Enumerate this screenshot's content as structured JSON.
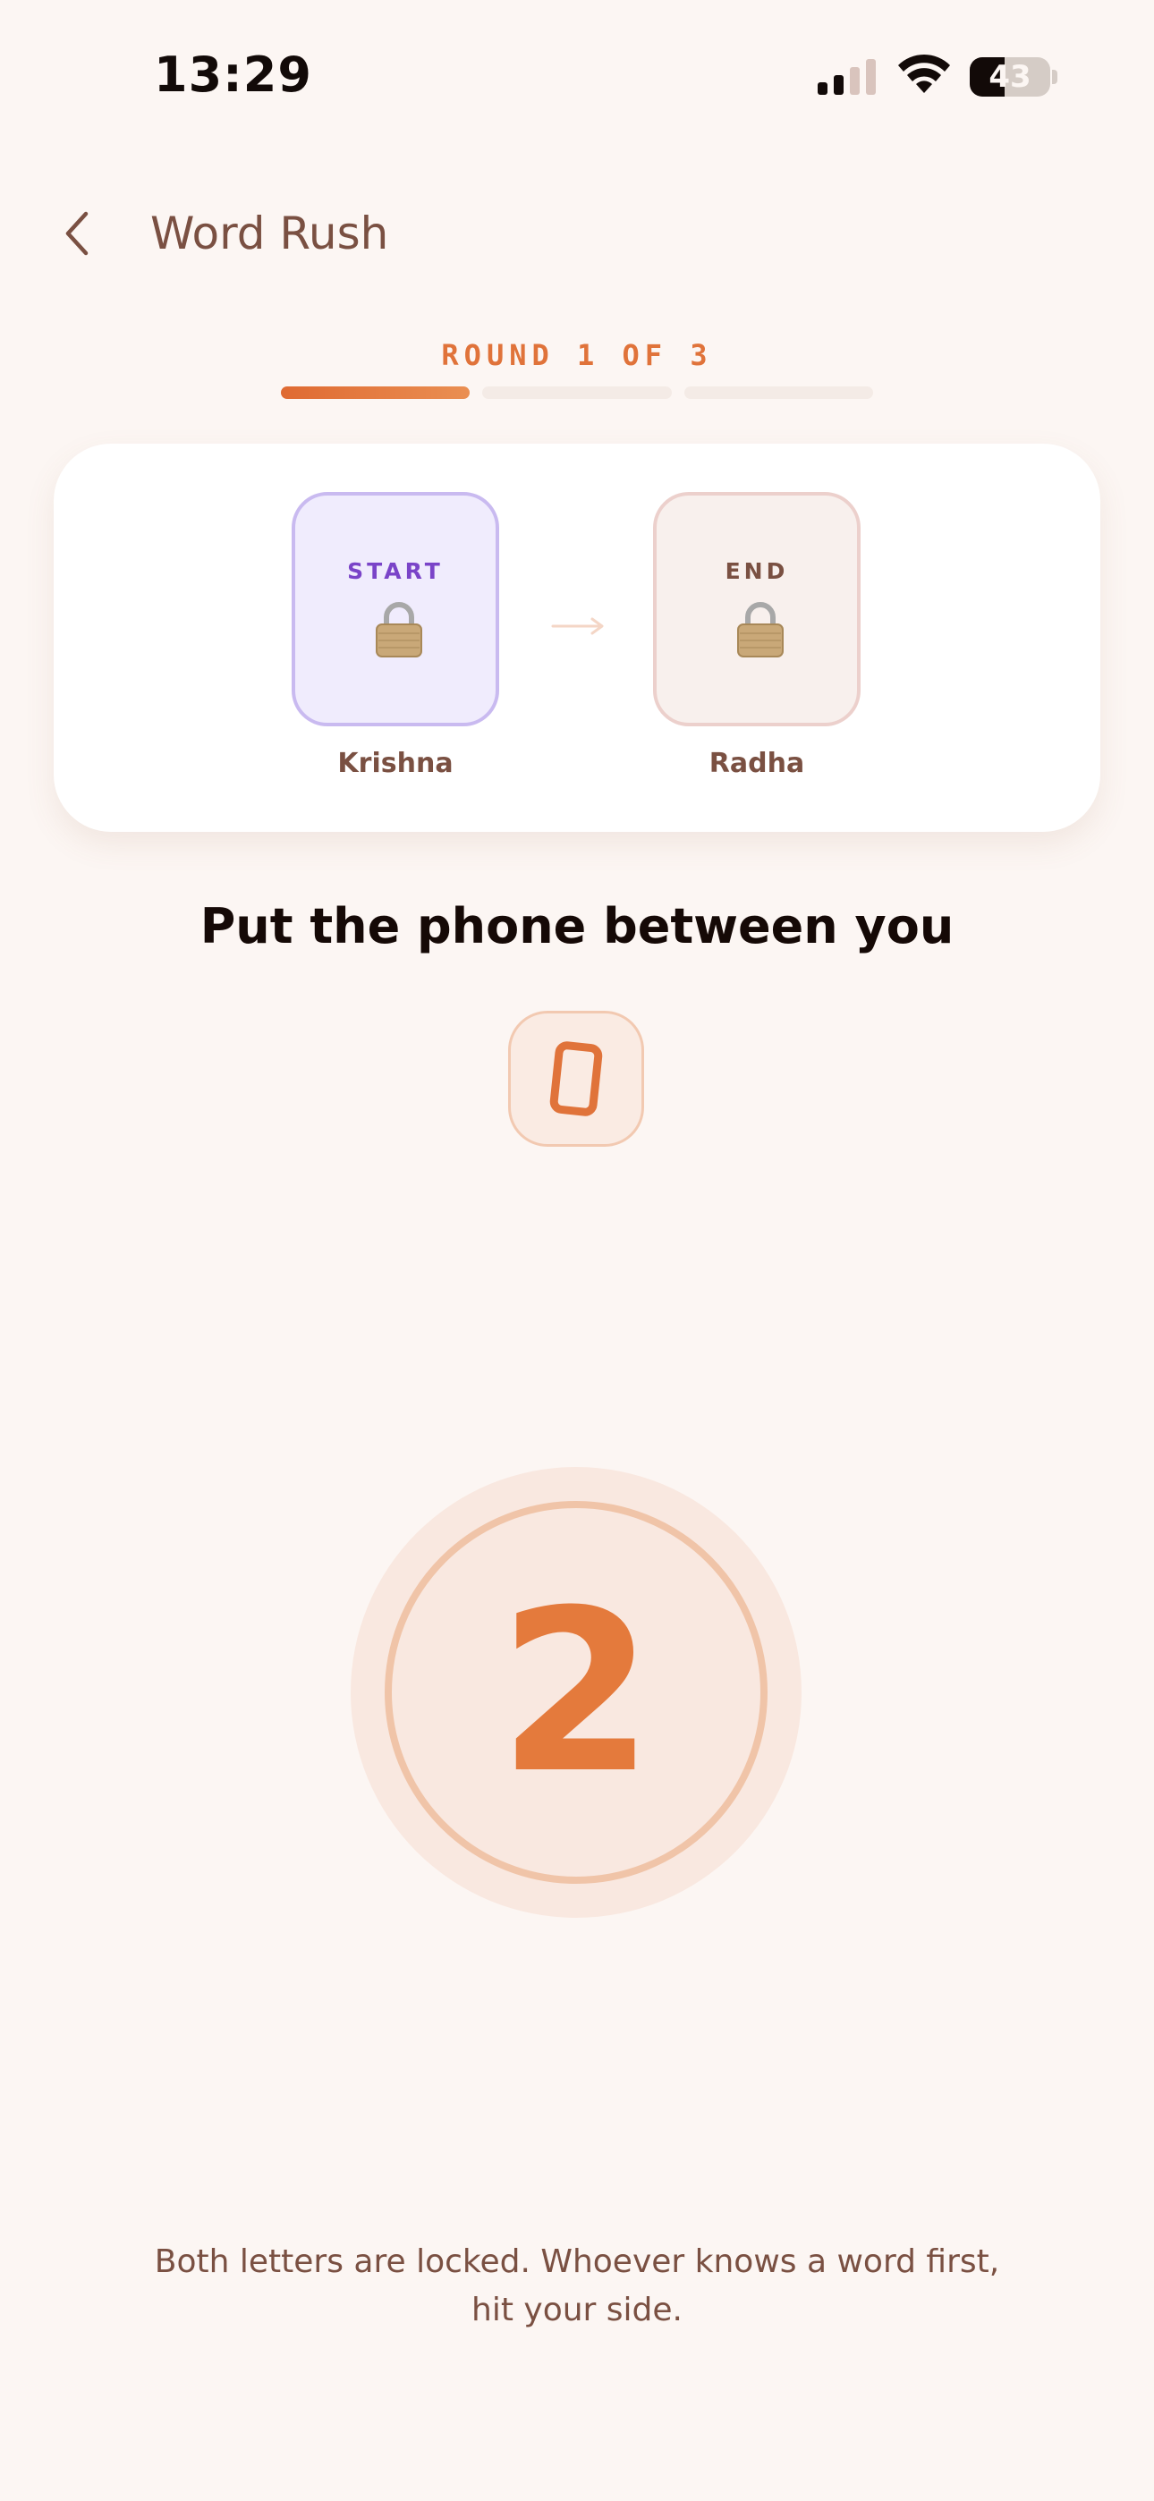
{
  "status_bar": {
    "time": "13:29",
    "battery_level": "43",
    "battery_fraction": 0.43
  },
  "nav": {
    "title": "Word Rush",
    "back_icon": "chevron-left-icon"
  },
  "round": {
    "label": "ROUND 1 OF 3",
    "current": 1,
    "total": 3
  },
  "players": {
    "start": {
      "tag": "START",
      "name": "Krishna",
      "icon": "lock-icon"
    },
    "end": {
      "tag": "END",
      "name": "Radha",
      "icon": "lock-icon"
    },
    "arrow_icon": "arrow-right-icon"
  },
  "instruction": {
    "headline": "Put the phone between you",
    "icon": "phone-icon"
  },
  "countdown": {
    "value": "2"
  },
  "footer": {
    "text": "Both letters are locked. Whoever knows a word first, hit your side."
  },
  "colors": {
    "background": "#fcf6f3",
    "accent": "#e0733a",
    "start_purple": "#7a44c8",
    "text_brown": "#7a5042"
  }
}
